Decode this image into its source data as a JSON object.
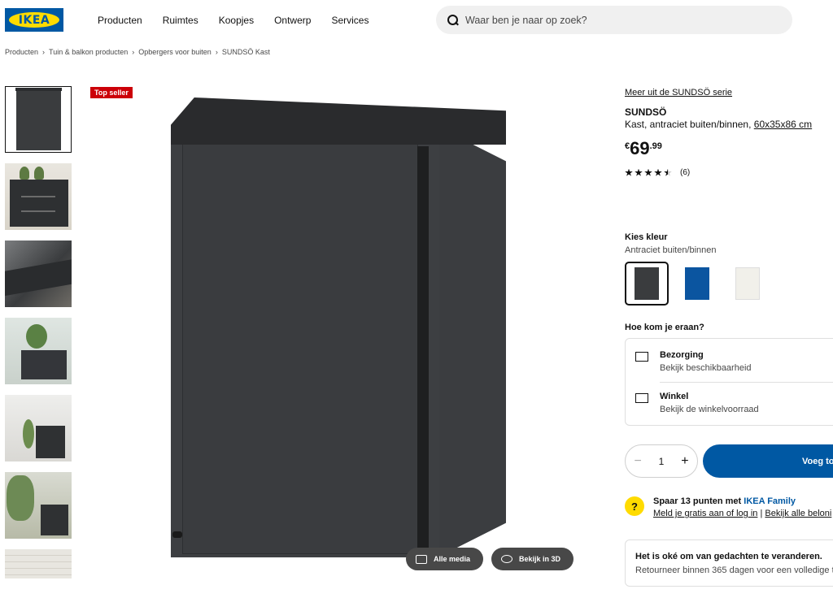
{
  "header": {
    "logo_text": "IKEA",
    "nav": [
      "Producten",
      "Ruimtes",
      "Koopjes",
      "Ontwerp",
      "Services"
    ],
    "search_placeholder": "Waar ben je naar op zoek?"
  },
  "breadcrumb": [
    "Producten",
    "Tuin & balkon producten",
    "Opbergers voor buiten",
    "SUNDSÖ Kast"
  ],
  "gallery": {
    "badge": "Top seller",
    "all_media": "Alle media",
    "view_3d": "Bekijk in 3D"
  },
  "product": {
    "series_link": "Meer uit de SUNDSÖ serie",
    "name": "SUNDSÖ",
    "description": "Kast, antraciet buiten/binnen,",
    "dimensions": "60x35x86 cm",
    "currency": "€",
    "price_int": "69",
    "price_dec": ".99",
    "rating": 4.5,
    "review_count": "(6)"
  },
  "color": {
    "heading": "Kies kleur",
    "selected": "Antraciet buiten/binnen",
    "options": [
      {
        "name": "antraciet",
        "hex": "#3a3c3e"
      },
      {
        "name": "blauw",
        "hex": "#0b55a0"
      },
      {
        "name": "wit",
        "hex": "#f1f0ea"
      }
    ]
  },
  "fulfillment": {
    "heading": "Hoe kom je eraan?",
    "delivery_title": "Bezorging",
    "delivery_sub": "Bekijk beschikbaarheid",
    "store_title": "Winkel",
    "store_sub": "Bekijk de winkelvoorraad"
  },
  "purchase": {
    "quantity": "1",
    "minus": "−",
    "plus": "+",
    "add_label": "Voeg to"
  },
  "family": {
    "icon": "?",
    "text": "Spaar 13 punten met ",
    "brand": "IKEA Family",
    "link1": "Meld je gratis aan of log in",
    "sep": " | ",
    "link2": "Bekijk alle beloni"
  },
  "returns": {
    "title": "Het is oké om van gedachten te veranderen.",
    "sub": "Retourneer binnen 365 dagen voor een volledige t"
  },
  "colors": {
    "brand_blue": "#0058a3",
    "brand_yellow": "#ffdb00",
    "badge_red": "#cc0008"
  }
}
